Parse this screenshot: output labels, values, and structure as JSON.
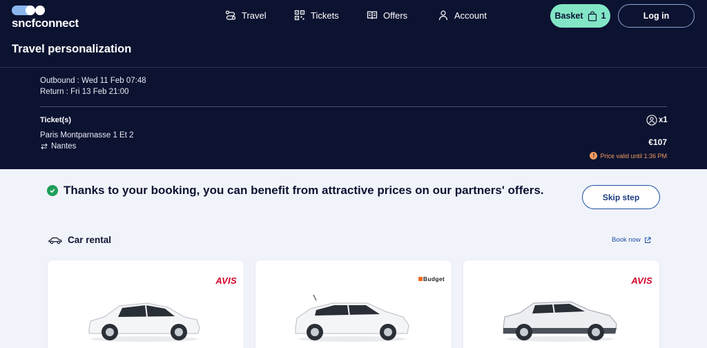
{
  "brand": {
    "name": "sncfconnect"
  },
  "nav": {
    "items": [
      {
        "label": "Travel",
        "icon": "route-icon"
      },
      {
        "label": "Tickets",
        "icon": "qr-code-icon"
      },
      {
        "label": "Offers",
        "icon": "book-icon"
      },
      {
        "label": "Account",
        "icon": "user-icon"
      }
    ],
    "basket_label": "Basket",
    "basket_count": "1",
    "login_label": "Log in"
  },
  "page": {
    "title": "Travel personalization"
  },
  "trip": {
    "outbound": "Outbound : Wed 11 Feb 07:48",
    "return": "Return : Fri 13 Feb 21:00",
    "tickets_label": "Ticket(s)",
    "from": "Paris Montparnasse 1 Et 2",
    "to": "Nantes",
    "passengers": "x1",
    "price": "€107",
    "price_valid": "Price valid until 1:36 PM"
  },
  "partners": {
    "message": "Thanks to your booking, you can benefit from attractive prices on our partners' offers.",
    "skip_label": "Skip step",
    "section_title": "Car rental",
    "book_now": "Book now",
    "cards": [
      {
        "brand": "AVIS"
      },
      {
        "brand": "Budget"
      },
      {
        "brand": "AVIS"
      }
    ]
  },
  "colors": {
    "navy": "#0c1331",
    "mint": "#82e6c6",
    "accent_blue": "#1b4fa0",
    "warning": "#f29b5e",
    "success": "#1e9e5a",
    "avis_red": "#d4002a"
  }
}
